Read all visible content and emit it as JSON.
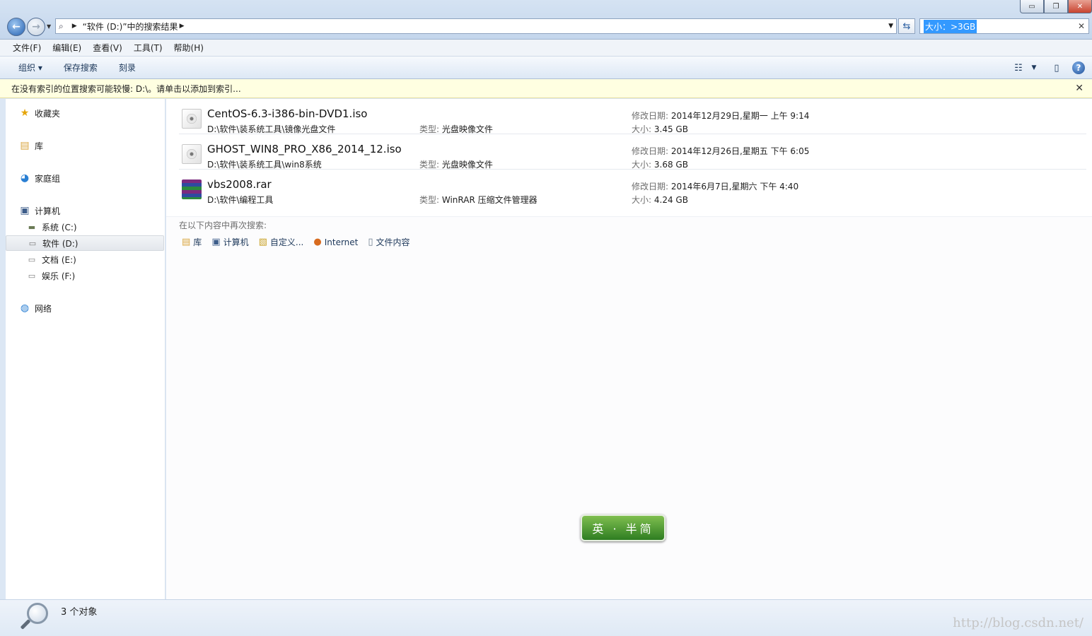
{
  "window": {
    "controls": {
      "minimize": "▭",
      "maximize": "❐",
      "close": "✕"
    }
  },
  "address": {
    "crumb": "“软件 (D:)”中的搜索结果"
  },
  "search": {
    "value": "大小：>3GB",
    "clear": "✕"
  },
  "menu": [
    "文件(F)",
    "编辑(E)",
    "查看(V)",
    "工具(T)",
    "帮助(H)"
  ],
  "toolbar": {
    "organize": "组织 ▾",
    "save_search": "保存搜索",
    "burn": "刻录",
    "help": "?"
  },
  "infobar": {
    "text": "在没有索引的位置搜索可能较慢: D:\\。请单击以添加到索引...",
    "close": "✕"
  },
  "nav": {
    "favorites": "收藏夹",
    "libraries": "库",
    "homegroup": "家庭组",
    "computer": "计算机",
    "drives": [
      "系统 (C:)",
      "软件 (D:)",
      "文档 (E:)",
      "娱乐 (F:)"
    ],
    "network": "网络"
  },
  "results": [
    {
      "name": "CentOS-6.3-i386-bin-DVD1.iso",
      "path": "D:\\软件\\装系统工具\\镜像光盘文件",
      "type_label": "类型:",
      "type": "光盘映像文件",
      "date_label": "修改日期:",
      "date": "2014年12月29日,星期一 上午 9:14",
      "size_label": "大小:",
      "size": "3.45 GB",
      "icon": "disc-image-icon"
    },
    {
      "name": "GHOST_WIN8_PRO_X86_2014_12.iso",
      "path": "D:\\软件\\装系统工具\\win8系统",
      "type_label": "类型:",
      "type": "光盘映像文件",
      "date_label": "修改日期:",
      "date": "2014年12月26日,星期五 下午 6:05",
      "size_label": "大小:",
      "size": "3.68 GB",
      "icon": "disc-image-icon"
    },
    {
      "name": "vbs2008.rar",
      "path": "D:\\软件\\编程工具",
      "type_label": "类型:",
      "type": "WinRAR 压缩文件管理器",
      "date_label": "修改日期:",
      "date": "2014年6月7日,星期六 下午 4:40",
      "size_label": "大小:",
      "size": "4.24 GB",
      "icon": "winrar-archive-icon"
    }
  ],
  "search_again": {
    "label": "在以下内容中再次搜索:",
    "links": [
      "库",
      "计算机",
      "自定义...",
      "Internet",
      "文件内容"
    ]
  },
  "badge": {
    "text": "英 · 半简"
  },
  "status": {
    "count": "3 个对象"
  },
  "watermark": "http://blog.csdn.net/"
}
